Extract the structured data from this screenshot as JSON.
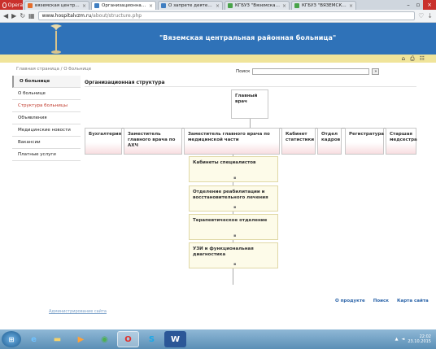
{
  "browser": {
    "opera_label": "Opera",
    "tabs": [
      {
        "label": "вяземская центральная р",
        "active": false,
        "color": "#e46d2b"
      },
      {
        "label": "Организационная структ",
        "active": true,
        "color": "#3f7ec1"
      },
      {
        "label": "О запрете деятельност",
        "active": false,
        "color": "#3f7ec1"
      },
      {
        "label": "КГБУЗ \"Вяземская РБ\"",
        "active": false,
        "color": "#49a34a"
      },
      {
        "label": "КГБУЗ \"ВЯЗЕМСКАЯ РАЙ",
        "active": false,
        "color": "#49a34a"
      }
    ],
    "url_host": "www.hospitalvzm.ru",
    "url_path": "/about/structure.php"
  },
  "header": {
    "title": "\"Вяземская центральная районная больница\""
  },
  "breadcrumb": "Главная страница / О больнице",
  "search": {
    "label": "Поиск",
    "go": "»"
  },
  "sidebar": {
    "items": [
      {
        "label": "О больнице",
        "state": "head"
      },
      {
        "label": "О больнице",
        "state": ""
      },
      {
        "label": "Структура больницы",
        "state": "current"
      },
      {
        "label": "Объявления",
        "state": ""
      },
      {
        "label": "Медицинские новости",
        "state": ""
      },
      {
        "label": "Вакансии",
        "state": ""
      },
      {
        "label": "Платные услуги",
        "state": ""
      }
    ]
  },
  "main": {
    "title": "Организационная структура",
    "chief": "Главный врач",
    "departments": [
      "Бухгалтерия",
      "Заместитель главного врача по АХЧ",
      "Заместитель главного врача по медицинской части",
      "Кабинет статистики",
      "Отдел кадров",
      "Регистратура",
      "Старшая медсестра"
    ],
    "sub_units": [
      "Кабинеты специалистов",
      "Отделение реабилитации и восстановительного лечения",
      "Терапевтическое отделение",
      "УЗИ и функциональная диагностика"
    ]
  },
  "footer": {
    "links": [
      "О продукте",
      "Поиск",
      "Карта сайта"
    ],
    "small_link": "Администрирование сайта"
  },
  "taskbar": {
    "time": "22:02",
    "date": "23.10.2015"
  }
}
